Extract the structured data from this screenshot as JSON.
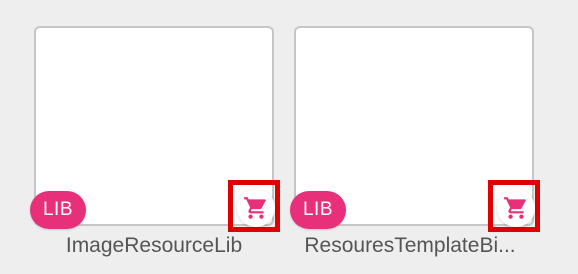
{
  "accent_color": "#e8307a",
  "highlight_color": "#e00000",
  "items": [
    {
      "badge": "LIB",
      "title": "ImageResourceLib",
      "cart_icon": "shopping-cart-icon"
    },
    {
      "badge": "LIB",
      "title": "ResouresTemplateBi...",
      "cart_icon": "shopping-cart-icon"
    }
  ]
}
